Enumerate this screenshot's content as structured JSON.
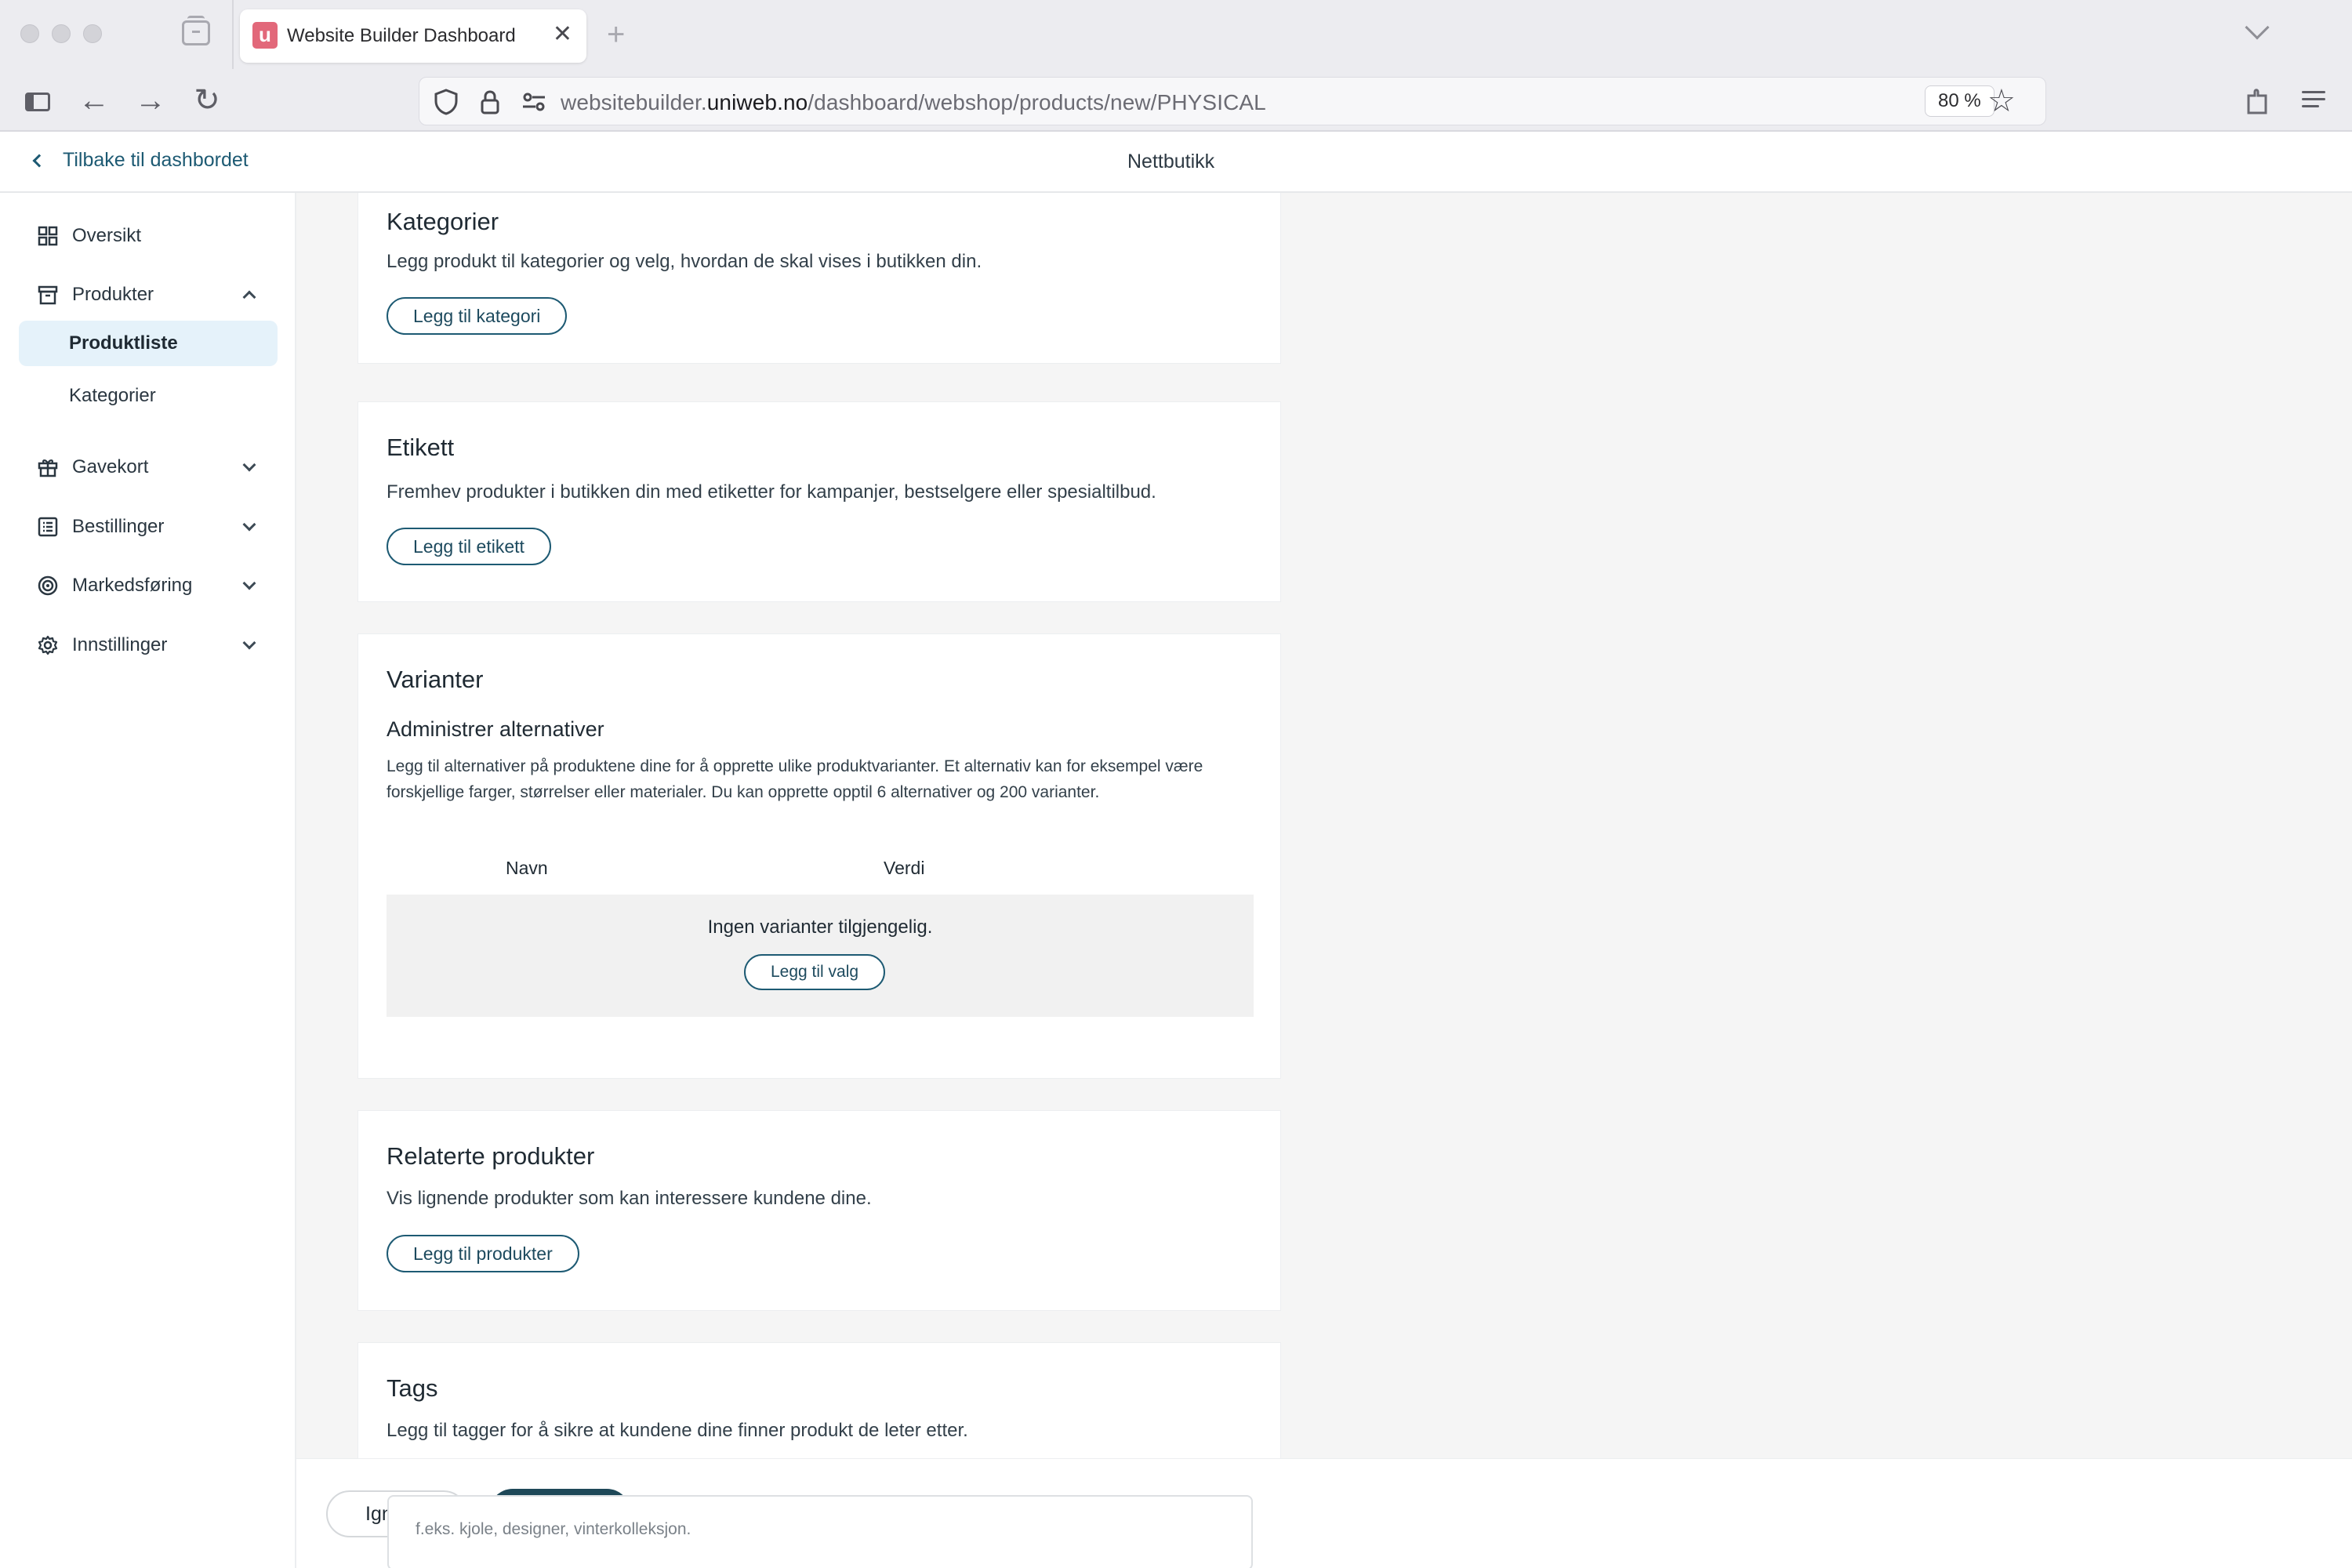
{
  "browser": {
    "tab_title": "Website Builder Dashboard",
    "tab_favicon_letter": "u",
    "tab_close": "✕",
    "new_tab": "+",
    "url_prefix": "websitebuilder.",
    "url_host": "uniweb.no",
    "url_path": "/dashboard/webshop/products/new/PHYSICAL",
    "zoom": "80 %",
    "back_arrow": "←",
    "forward_arrow": "→",
    "reload": "↻",
    "bookmark_star": "☆",
    "accent_color": "#e2687a"
  },
  "header": {
    "back_label": "Tilbake til dashbordet",
    "title": "Nettbutikk"
  },
  "sidebar": {
    "items": [
      {
        "label": "Oversikt",
        "icon": "grid-icon"
      },
      {
        "label": "Produkter",
        "icon": "archive-box-icon",
        "expanded": true
      },
      {
        "label": "Produktliste",
        "active": true
      },
      {
        "label": "Kategorier"
      },
      {
        "label": "Gavekort",
        "icon": "gift-icon"
      },
      {
        "label": "Bestillinger",
        "icon": "list-icon"
      },
      {
        "label": "Markedsføring",
        "icon": "target-icon"
      },
      {
        "label": "Innstillinger",
        "icon": "gear-icon"
      }
    ],
    "active_bg": "#e5f2fa"
  },
  "main": {
    "kategorier": {
      "title": "Kategorier",
      "description": "Legg produkt til kategorier og velg, hvordan de skal vises i butikken din.",
      "button": "Legg til kategori"
    },
    "etikett": {
      "title": "Etikett",
      "description": "Fremhev produkter i butikken din med etiketter for kampanjer, bestselgere eller spesialtilbud.",
      "button": "Legg til etikett"
    },
    "varianter": {
      "title": "Varianter",
      "subtitle": "Administrer alternativer",
      "description": "Legg til alternativer på produktene dine for å opprette ulike produktvarianter. Et alternativ kan for eksempel være forskjellige farger, størrelser eller materialer. Du kan opprette opptil 6 alternativer og 200 varianter.",
      "col_name": "Navn",
      "col_value": "Verdi",
      "empty_text": "Ingen varianter tilgjengelig.",
      "empty_button": "Legg til valg"
    },
    "relaterte": {
      "title": "Relaterte produkter",
      "description": "Vis lignende produkter som kan interessere kundene dine.",
      "button": "Legg til produkter"
    },
    "tags": {
      "title": "Tags",
      "description": "Legg til tagger for å sikre at kundene dine finner produkt de leter etter.",
      "placeholder": "f.eks. kjole, designer, vinterkolleksjon."
    }
  },
  "footer": {
    "ignore_label": "Ignorer",
    "primary_color": "#1e4858"
  }
}
